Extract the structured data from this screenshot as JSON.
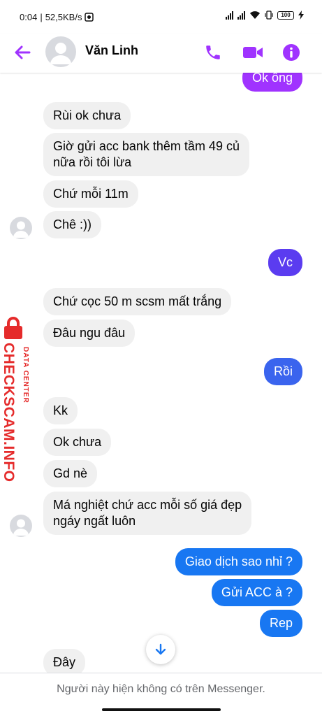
{
  "status_bar": {
    "time": "0:04",
    "network_speed": "52,5KB/s",
    "battery_level": "100"
  },
  "header": {
    "contact_name": "Văn Linh",
    "icons": {
      "back": "arrow-left-icon",
      "call": "phone-icon",
      "video": "video-camera-icon",
      "info": "info-icon"
    }
  },
  "colors": {
    "accent_purple": "#a033ff",
    "bubble_purple": "#8b2cf5",
    "bubble_indigo": "#5b3cf0",
    "bubble_blue": "#1877f2",
    "incoming_bubble": "#f0f0f0",
    "watermark_red": "#e52b2b"
  },
  "messages": [
    {
      "side": "out",
      "text": "Ok ông"
    },
    {
      "side": "in",
      "text": "Rùi ok chưa"
    },
    {
      "side": "in",
      "text": "Giờ gửi acc bank thêm tầm 49 củ\nnữa rồi tôi lừa"
    },
    {
      "side": "in",
      "text": "Chứ mỗi 11m"
    },
    {
      "side": "in",
      "text": "Chê :))"
    },
    {
      "side": "out",
      "text": "Vc"
    },
    {
      "side": "in",
      "text": "Chứ cọc 50 m scsm mất trắng"
    },
    {
      "side": "in",
      "text": "Đâu ngu đâu"
    },
    {
      "side": "out",
      "text": "Rồi"
    },
    {
      "side": "in",
      "text": "Kk"
    },
    {
      "side": "in",
      "text": "Ok chưa"
    },
    {
      "side": "in",
      "text": "Gd nè"
    },
    {
      "side": "in",
      "text": "Má nghiệt chứ acc mỗi số giá đẹp\nngáy ngất luôn"
    },
    {
      "side": "out",
      "text": "Giao dịch sao nhỉ ?"
    },
    {
      "side": "out",
      "text": "Gửi ACC à ?"
    },
    {
      "side": "out",
      "text": "Rep"
    },
    {
      "side": "in",
      "text": "Đây"
    }
  ],
  "watermark": {
    "brand": "CHECKSCAM.INFO",
    "tagline": "DATA CENTER"
  },
  "scroll_down": {
    "icon": "arrow-down-icon"
  },
  "footer": {
    "notice": "Người này hiện không có trên Messenger."
  }
}
